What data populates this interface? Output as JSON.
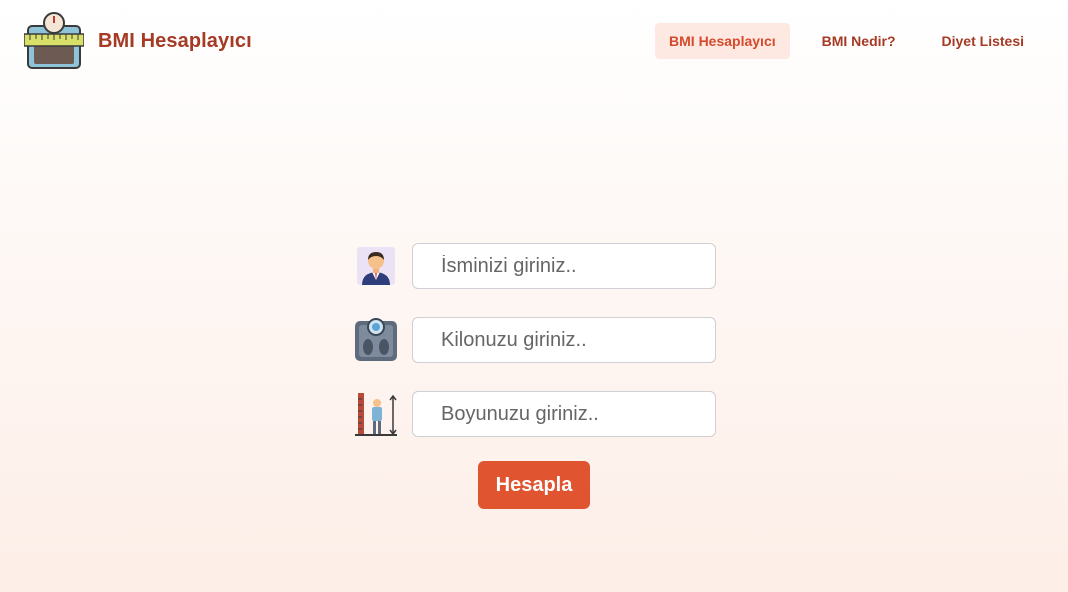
{
  "brand": {
    "title": "BMI Hesaplayıcı",
    "logo_icon": "bathroom-scale-tape-icon"
  },
  "nav": {
    "items": [
      {
        "label": "BMI Hesaplayıcı",
        "active": true
      },
      {
        "label": "BMI Nedir?",
        "active": false
      },
      {
        "label": "Diyet Listesi",
        "active": false
      }
    ]
  },
  "form": {
    "name": {
      "placeholder": "İsminizi giriniz..",
      "value": "",
      "icon": "person-avatar-icon"
    },
    "weight": {
      "placeholder": "Kilonuzu giriniz..",
      "value": "",
      "icon": "weight-scale-icon"
    },
    "height": {
      "placeholder": "Boyunuzu giriniz..",
      "value": "",
      "icon": "height-measure-icon"
    },
    "submit_label": "Hesapla"
  },
  "colors": {
    "brand": "#a53a25",
    "accent": "#e0542f",
    "active_nav_bg": "#fde9e1"
  }
}
